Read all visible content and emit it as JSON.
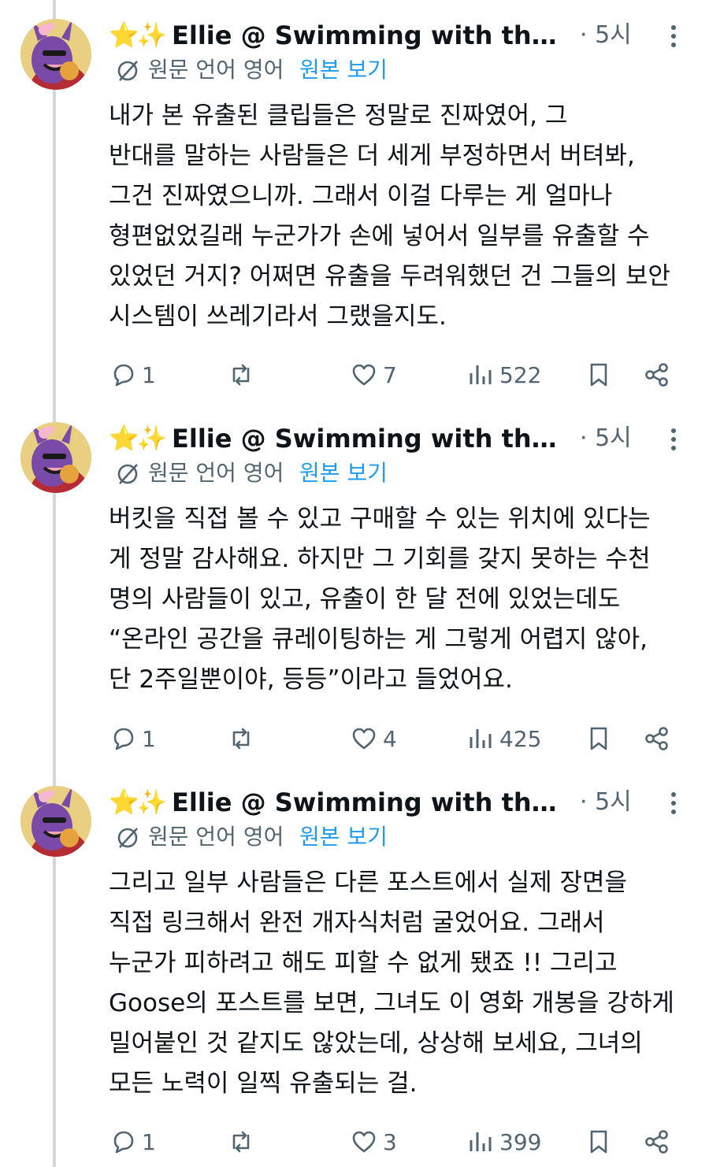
{
  "posts": [
    {
      "stars": "⭐✨",
      "author": "Ellie @ Swimming with the St...",
      "time": "· 5시",
      "translate": {
        "original_lang": "원문 언어 영어",
        "show_original": "원본 보기"
      },
      "lines": [
        "내가 본 유출된 클립들은 정말로 진짜였어, 그",
        "반대를 말하는 사람들은 더 세게 부정하면서 버텨봐,",
        "그건 진짜였으니까. 그래서 이걸 다루는 게 얼마나",
        "형편없었길래 누군가가 손에 넣어서 일부를 유출할 수",
        "있었던 거지? 어쩌면 유출을 두려워했던 건 그들의 보안",
        "시스템이 쓰레기라서 그랬을지도."
      ],
      "replies": "1",
      "reposts": "",
      "likes": "7",
      "views": "522"
    },
    {
      "stars": "⭐✨",
      "author": "Ellie @ Swimming with the St...",
      "time": "· 5시",
      "translate": {
        "original_lang": "원문 언어 영어",
        "show_original": "원본 보기"
      },
      "lines": [
        "버킷을 직접 볼 수 있고 구매할 수 있는 위치에 있다는",
        "게 정말 감사해요. 하지만 그 기회를 갖지 못하는 수천",
        "명의 사람들이 있고, 유출이 한 달 전에 있었는데도",
        "“온라인 공간을 큐레이팅하는 게 그렇게 어렵지 않아,",
        "단 2주일뿐이야, 등등”이라고 들었어요."
      ],
      "replies": "1",
      "reposts": "",
      "likes": "4",
      "views": "425"
    },
    {
      "stars": "⭐✨",
      "author": "Ellie @ Swimming with the St...",
      "time": "· 5시",
      "translate": {
        "original_lang": "원문 언어 영어",
        "show_original": "원본 보기"
      },
      "lines": [
        "그리고 일부 사람들은 다른 포스트에서 실제 장면을",
        "직접 링크해서 완전 개자식처럼 굴었어요. 그래서",
        "누군가 피하려고 해도 피할 수 없게 됐죠 !! 그리고",
        "Goose의 포스트를 보면, 그녀도 이 영화 개봉을 강하게",
        "밀어붙인 것 같지도 않았는데, 상상해 보세요, 그녀의",
        "모든 노력이 일찍 유출되는 걸."
      ],
      "replies": "1",
      "reposts": "",
      "likes": "3",
      "views": "399"
    }
  ],
  "icons": {
    "avatar": "avatar-image",
    "globe": "translate-globe-icon",
    "reply": "reply-icon",
    "repost": "repost-icon",
    "like": "heart-icon",
    "views": "views-bar-chart-icon",
    "bookmark": "bookmark-icon",
    "share": "share-icon",
    "more": "more-vertical-icon"
  },
  "colors": {
    "link": "#1d9bf0",
    "muted": "#536471",
    "text": "#0f1419",
    "thread": "#cfd9de"
  }
}
